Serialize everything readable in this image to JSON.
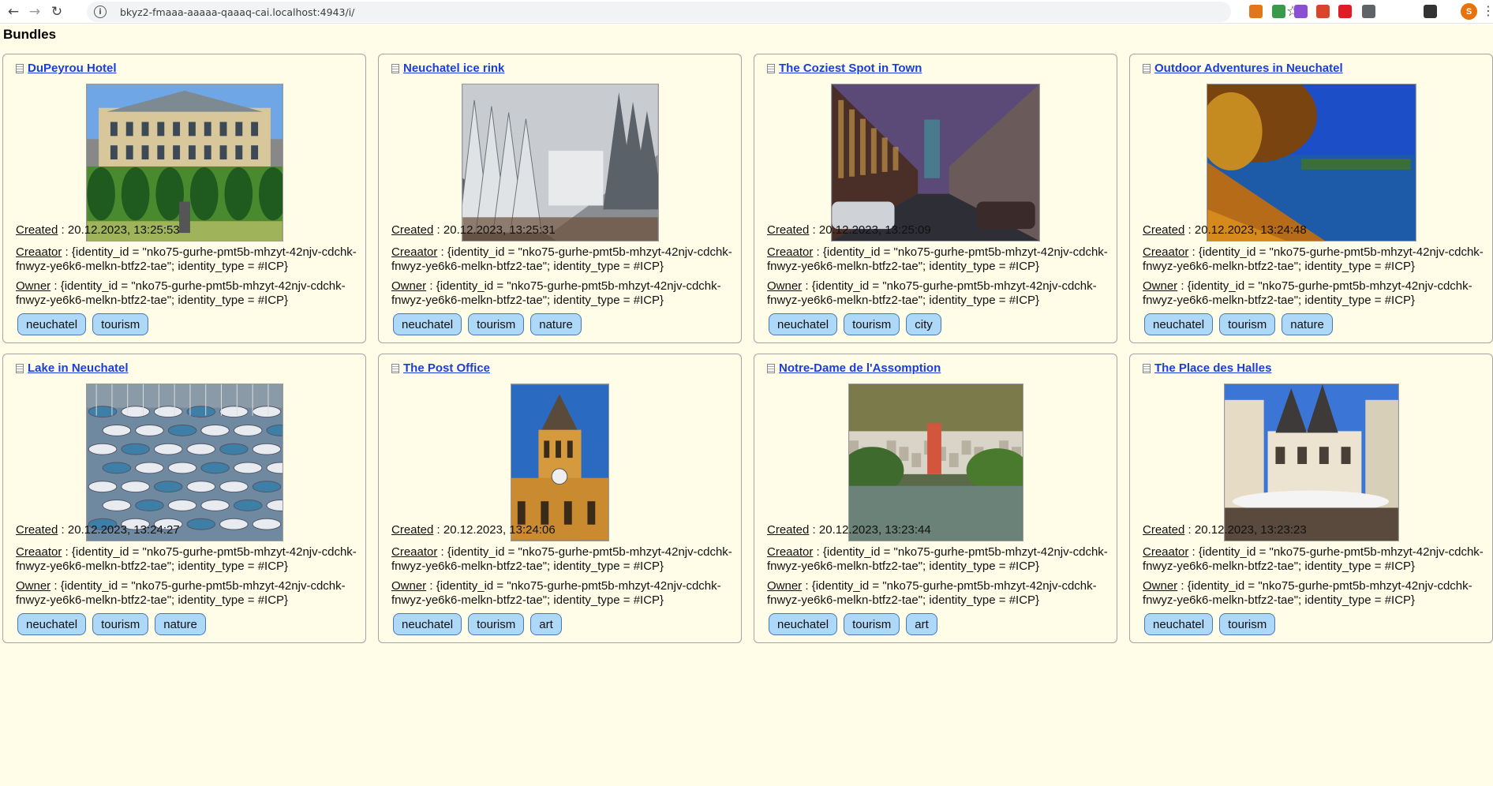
{
  "browser": {
    "url": "bkyz2-fmaaa-aaaaa-qaaaq-cai.localhost:4943/i/",
    "nav": {
      "back": "←",
      "forward": "→",
      "reload": "↻"
    },
    "info_icon": "i",
    "star_icon": "☆",
    "extensions": [
      {
        "name": "metamask-icon",
        "color": "#e2761b"
      },
      {
        "name": "extension-green-icon",
        "color": "#3a9a4a"
      },
      {
        "name": "extension-purple-icon",
        "color": "#8b4fd6"
      },
      {
        "name": "extension-red-burst-icon",
        "color": "#d9452c"
      },
      {
        "name": "extension-swiss-icon",
        "color": "#e01b24"
      },
      {
        "name": "puzzle-icon",
        "color": "#5f6368"
      },
      {
        "name": "side-panel-icon",
        "color": "#333333"
      }
    ],
    "profile_initial": "S",
    "menu_icon": "⋮"
  },
  "page": {
    "heading": "Bundles",
    "labels": {
      "created": "Created",
      "creator": "Creaator",
      "owner": "Owner"
    },
    "identity": "{identity_id = \"nko75-gurhe-pmt5b-mhzyt-42njv-cdchk-fnwyz-ye6k6-melkn-btfz2-tae\"; identity_type = #ICP}",
    "cards": [
      {
        "title": "DuPeyrou Hotel",
        "created": "20.12.2023, 13:25:53",
        "tags": [
          "neuchatel",
          "tourism"
        ],
        "image": {
          "kind": "mansion",
          "w": 250
        }
      },
      {
        "title": "Neuchatel ice rink",
        "created": "20.12.2023, 13:25:31",
        "tags": [
          "neuchatel",
          "tourism",
          "nature"
        ],
        "image": {
          "kind": "snow",
          "w": 250
        }
      },
      {
        "title": "The Coziest Spot in Town",
        "created": "20.12.2023, 13:25:09",
        "tags": [
          "neuchatel",
          "tourism",
          "city"
        ],
        "image": {
          "kind": "street",
          "w": 265
        }
      },
      {
        "title": "Outdoor Adventures in Neuchatel",
        "created": "20.12.2023, 13:24:48",
        "tags": [
          "neuchatel",
          "tourism",
          "nature"
        ],
        "image": {
          "kind": "autumn",
          "w": 266
        }
      },
      {
        "title": "Lake in Neuchatel",
        "created": "20.12.2023, 13:24:27",
        "tags": [
          "neuchatel",
          "tourism",
          "nature"
        ],
        "image": {
          "kind": "marina",
          "w": 250
        }
      },
      {
        "title": "The Post Office",
        "created": "20.12.2023, 13:24:06",
        "tags": [
          "neuchatel",
          "tourism",
          "art"
        ],
        "image": {
          "kind": "tower",
          "w": 125
        }
      },
      {
        "title": "Notre-Dame de l'Assomption",
        "created": "20.12.2023, 13:23:44",
        "tags": [
          "neuchatel",
          "tourism",
          "art"
        ],
        "image": {
          "kind": "lakeview",
          "w": 222
        }
      },
      {
        "title": "The Place des Halles",
        "created": "20.12.2023, 13:23:23",
        "tags": [
          "neuchatel",
          "tourism"
        ],
        "image": {
          "kind": "square",
          "w": 222
        }
      }
    ]
  }
}
